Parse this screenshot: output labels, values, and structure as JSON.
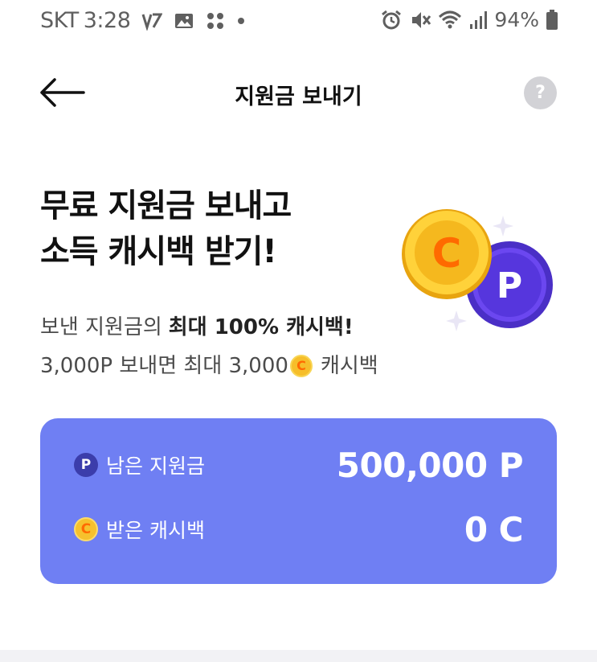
{
  "status_bar": {
    "carrier": "SKT",
    "time": "3:28",
    "battery_pct": "94%",
    "icons_left": [
      "volte-icon",
      "image-icon",
      "apps-icon",
      "dot-icon"
    ],
    "icons_right": [
      "alarm-icon",
      "mute-icon",
      "wifi-icon",
      "signal-icon",
      "battery-icon"
    ]
  },
  "header": {
    "title": "지원금 보내기",
    "help_label": "?"
  },
  "hero": {
    "title_line1": "무료 지원금 보내고",
    "title_line2": "소득 캐시백 받기!",
    "desc_line1_prefix": "보낸 지원금의",
    "desc_line1_bold": "최대 100% 캐시백!",
    "desc_line2_prefix": "3,000P 보내면 최대 3,000",
    "desc_line2_coin": "C",
    "desc_line2_suffix": "캐시백"
  },
  "balance_card": {
    "remaining_badge": "P",
    "remaining_label": "남은 지원금",
    "remaining_value": "500,000 P",
    "cashback_badge": "C",
    "cashback_label": "받은 캐시백",
    "cashback_value": "0 C"
  },
  "colors": {
    "card_bg": "#6f7ff3",
    "coin_gold": "#f6c12d",
    "coin_orange": "#ff6a00",
    "coin_purple": "#5a3fd8"
  }
}
